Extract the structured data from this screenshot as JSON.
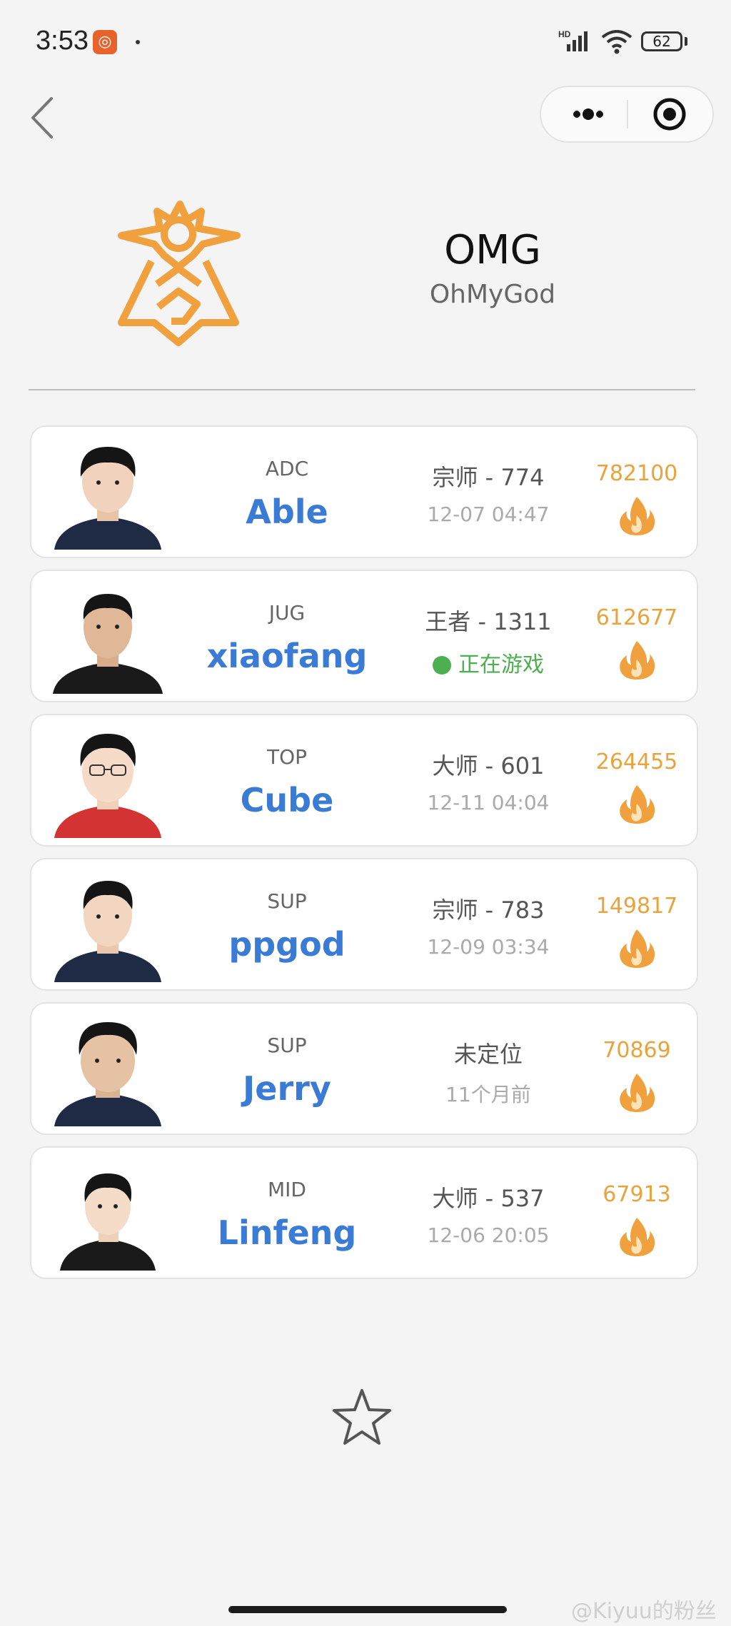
{
  "status_bar": {
    "time": "3:53",
    "battery": "62",
    "app_badge_icon": "kuaishou-icon",
    "signal_label": "HD"
  },
  "nav": {
    "back_icon": "chevron-left-icon",
    "more_icon": "more-dots-icon",
    "target_icon": "target-icon"
  },
  "team": {
    "code": "OMG",
    "full_name": "OhMyGod",
    "logo_icon": "omg-logo-icon",
    "brand_color": "#f0a03c"
  },
  "players": [
    {
      "position": "ADC",
      "name": "Able",
      "rank": "宗师 - 774",
      "last_seen": "12-07 04:47",
      "online": false,
      "heat": "782100",
      "jersey_color": "#1f2a44"
    },
    {
      "position": "JUG",
      "name": "xiaofang",
      "rank": "王者 - 1311",
      "last_seen": "正在游戏",
      "online": true,
      "heat": "612677",
      "jersey_color": "#1a1a1a"
    },
    {
      "position": "TOP",
      "name": "Cube",
      "rank": "大师 - 601",
      "last_seen": "12-11 04:04",
      "online": false,
      "heat": "264455",
      "jersey_color": "#d33333"
    },
    {
      "position": "SUP",
      "name": "ppgod",
      "rank": "宗师 - 783",
      "last_seen": "12-09 03:34",
      "online": false,
      "heat": "149817",
      "jersey_color": "#1f2a44"
    },
    {
      "position": "SUP",
      "name": "Jerry",
      "rank": "未定位",
      "last_seen": "11个月前",
      "online": false,
      "heat": "70869",
      "jersey_color": "#1f2a44"
    },
    {
      "position": "MID",
      "name": "Linfeng",
      "rank": "大师 - 537",
      "last_seen": "12-06 20:05",
      "online": false,
      "heat": "67913",
      "jersey_color": "#1a1a1a"
    }
  ],
  "footer": {
    "favorite_icon": "star-outline-icon",
    "watermark": "@Kiyuu的粉丝"
  },
  "colors": {
    "name_blue": "#3a7bd5",
    "heat_orange": "#e9a33c",
    "online_green": "#4caf50"
  }
}
